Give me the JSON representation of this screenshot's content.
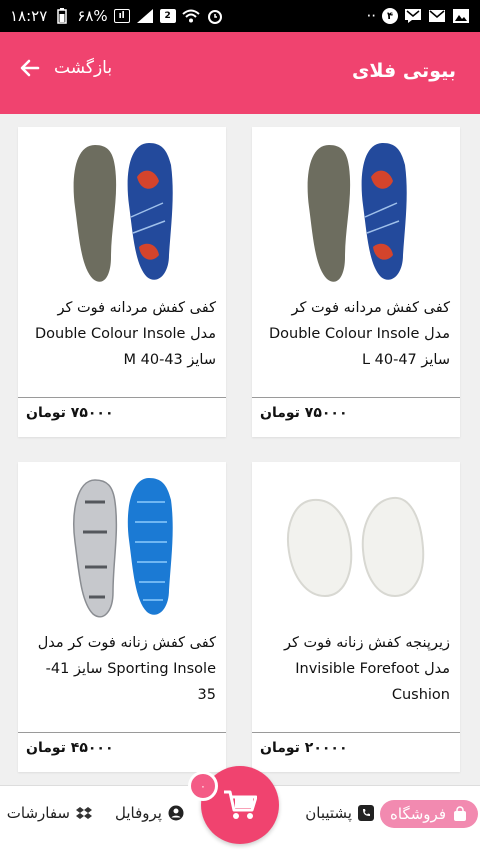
{
  "statusbar": {
    "time": "۱۸:۲۷",
    "battery": "۶۸%",
    "notification_count": "۴",
    "sim_label": "2"
  },
  "appbar": {
    "title": "بیوتی فلای",
    "back_label": "بازگشت"
  },
  "products": [
    {
      "name": "کفی کفش مردانه فوت کر مدل Double Colour Insole سایز 47-40 L",
      "price": "۷۵۰۰۰ تومان",
      "image": "insole-blue-gray"
    },
    {
      "name": "کفی کفش مردانه فوت کر مدل Double Colour Insole سایز 43-40 M",
      "price": "۷۵۰۰۰ تومان",
      "image": "insole-blue-gray"
    },
    {
      "name": "زیرپنجه کفش زنانه فوت کر مدل Invisible Forefoot Cushion",
      "price": "۲۰۰۰۰ تومان",
      "image": "gel-cushion"
    },
    {
      "name": "کفی کفش زنانه فوت کر مدل Sporting Insole سایز 41-35",
      "price": "۴۵۰۰۰ تومان",
      "image": "insole-sport"
    }
  ],
  "bottom_nav": {
    "store": "فروشگاه",
    "support": "پشتیبان",
    "profile": "پروفایل",
    "orders": "سفارشات",
    "cart_count": "۰"
  },
  "colors": {
    "accent": "#f0436f",
    "store_pill": "#f28ab0"
  }
}
